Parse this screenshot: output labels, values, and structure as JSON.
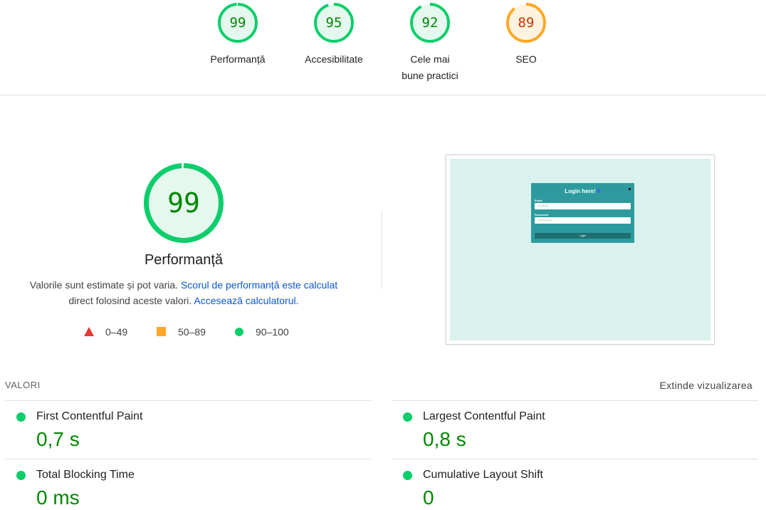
{
  "colors": {
    "pass": "#0cce6b",
    "pass_text": "#008800",
    "pass_fill": "#e5f8ee",
    "average": "#ffa726",
    "average_text": "#c33300",
    "average_fill": "#fff3e0",
    "fail": "#e53935",
    "link": "#0b57d0"
  },
  "gauges": [
    {
      "score": "99",
      "label": "Performanță",
      "rating": "pass",
      "value": 0.99
    },
    {
      "score": "95",
      "label": "Accesibilitate",
      "rating": "pass",
      "value": 0.95
    },
    {
      "score": "92",
      "label": "Cele mai bune practici",
      "rating": "pass",
      "value": 0.92
    },
    {
      "score": "89",
      "label": "SEO",
      "rating": "average",
      "value": 0.89
    }
  ],
  "performance": {
    "score": "99",
    "value": 0.99,
    "title": "Performanță",
    "desc_text1": "Valorile sunt estimate și pot varia.",
    "link1": "Scorul de performanță este calculat",
    "desc_text2": "direct folosind aceste valori.",
    "link2": "Accesează calculatorul",
    "desc_end": "."
  },
  "legend": [
    {
      "shape": "triangle",
      "range": "0–49"
    },
    {
      "shape": "square",
      "range": "50–89"
    },
    {
      "shape": "circle",
      "range": "90–100"
    }
  ],
  "screenshot": {
    "title": "Login here!",
    "email_label": "Email",
    "email_placeholder": "Type Email",
    "password_label": "Password",
    "password_placeholder": "Type Password",
    "button": "Login"
  },
  "metrics": {
    "header": "VALORI",
    "expand": "Extinde vizualizarea",
    "items": [
      {
        "title": "First Contentful Paint",
        "value": "0,7 s"
      },
      {
        "title": "Largest Contentful Paint",
        "value": "0,8 s"
      },
      {
        "title": "Total Blocking Time",
        "value": "0 ms"
      },
      {
        "title": "Cumulative Layout Shift",
        "value": "0"
      }
    ]
  }
}
